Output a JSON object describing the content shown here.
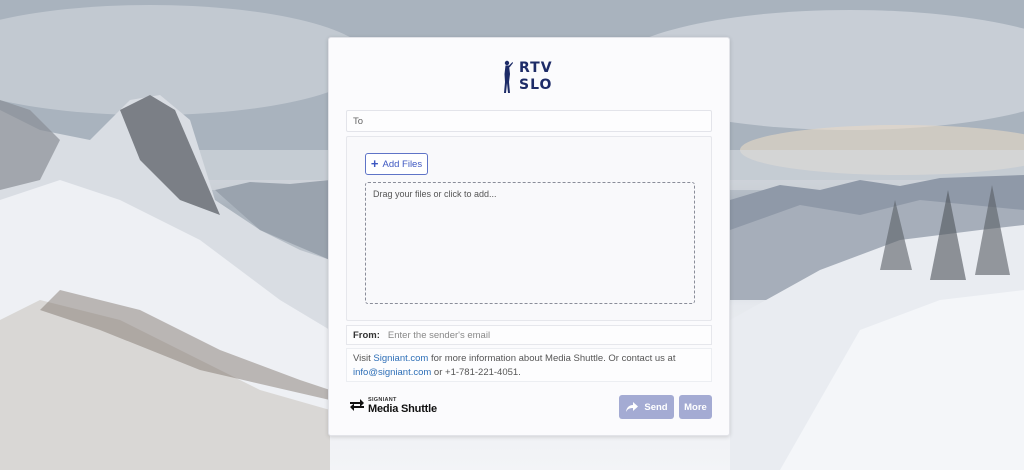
{
  "brand": {
    "logo_line1": "RTV",
    "logo_line2": "SLO",
    "color": "#1d2b67"
  },
  "form": {
    "to_label": "To",
    "add_files_label": "Add Files",
    "drop_hint": "Drag your files or click to add...",
    "from_label": "From:",
    "from_placeholder": "Enter the sender's email"
  },
  "info": {
    "prefix": "Visit ",
    "site_link": "Signiant.com",
    "middle": " for more information about Media Shuttle. Or contact us at ",
    "email_link": "info@signiant.com",
    "suffix": " or +1-781-221-4051."
  },
  "footer": {
    "signiant_label": "SIGNIANT",
    "product_name": "Media Shuttle",
    "send_label": "Send",
    "more_label": "More",
    "button_color": "#a4abd3"
  },
  "icons": {
    "plus": "plus-icon",
    "share": "share-arrow-icon",
    "arrows": "swap-arrows-icon",
    "logo_figure": "trumpeter-figure-icon"
  }
}
